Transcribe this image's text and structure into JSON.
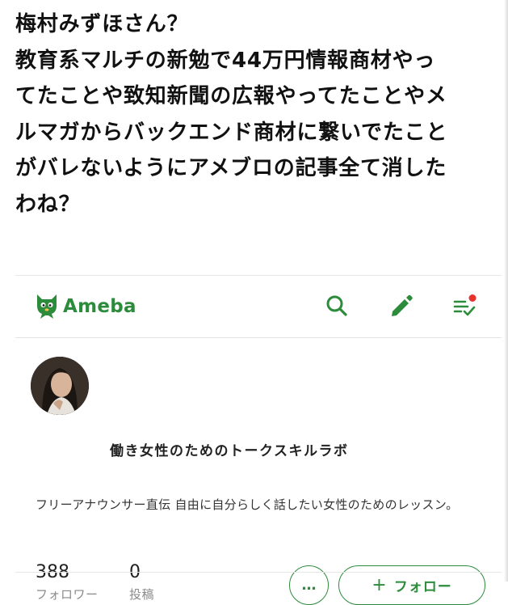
{
  "post": {
    "lines": [
      "梅村みずほさん？",
      "教育系マルチの新勉で44万円情報商材やっ",
      "てたことや致知新聞の広報やってたことやメ",
      "ルマガからバックエンド商材に繋いでたこと",
      "がバレないようにアメブロの記事全て消した",
      "わね？"
    ]
  },
  "ameba": {
    "logo_text": "Ameba",
    "brand_color": "#2d8c3c",
    "notification_color": "#e8322d",
    "icons": [
      "search-icon",
      "edit-pencil-icon",
      "feed-list-icon"
    ]
  },
  "profile": {
    "blog_title": "働き女性のためのトークスキルラボ",
    "description": "フリーアナウンサー直伝 自由に自分らしく話したい女性のためのレッスン。",
    "followers_count": "388",
    "followers_label": "フォロワー",
    "posts_count": "0",
    "posts_label": "投稿",
    "more_label": "…",
    "follow_plus": "+",
    "follow_label": "フォロー"
  }
}
